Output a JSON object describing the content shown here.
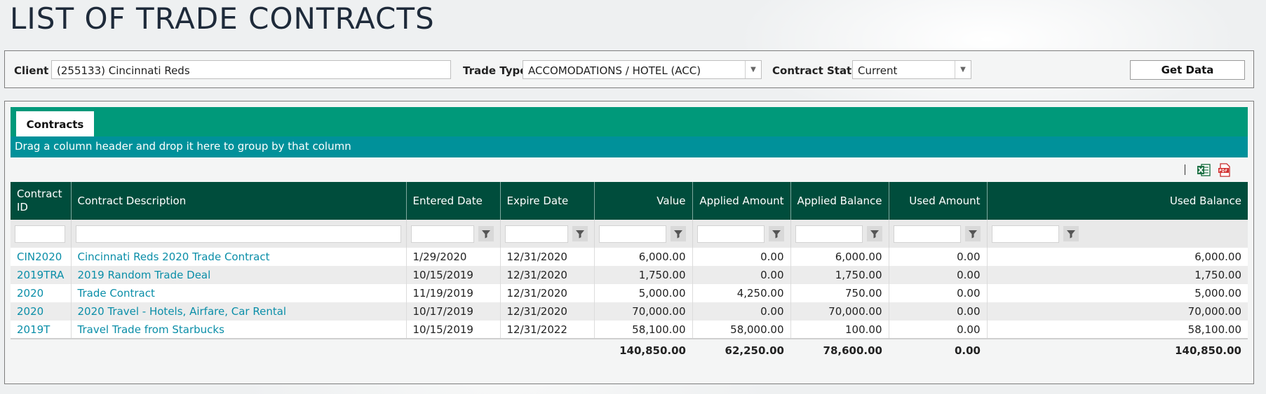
{
  "page": {
    "title": "LIST OF TRADE CONTRACTS"
  },
  "filters": {
    "client_label": "Client",
    "client_value": "(255133) Cincinnati Reds",
    "trade_type_label": "Trade Type",
    "trade_type_value": "ACCOMODATIONS / HOTEL (ACC)",
    "status_label": "Contract Status",
    "status_value": "Current",
    "get_data_label": "Get Data"
  },
  "tabs": [
    {
      "label": "Contracts",
      "active": true
    }
  ],
  "group_hint": "Drag a column header and drop it here to group by that column",
  "toolbar": {
    "icons": [
      "excel-export-icon",
      "pdf-export-icon"
    ]
  },
  "columns": [
    {
      "key": "id",
      "label": "Contract ID"
    },
    {
      "key": "desc",
      "label": "Contract Description"
    },
    {
      "key": "entered",
      "label": "Entered Date"
    },
    {
      "key": "expire",
      "label": "Expire Date"
    },
    {
      "key": "value",
      "label": "Value"
    },
    {
      "key": "applied_amount",
      "label": "Applied Amount"
    },
    {
      "key": "applied_balance",
      "label": "Applied Balance"
    },
    {
      "key": "used_amount",
      "label": "Used Amount"
    },
    {
      "key": "used_balance",
      "label": "Used Balance"
    }
  ],
  "rows": [
    {
      "id": "CIN2020",
      "desc": "Cincinnati Reds 2020 Trade Contract",
      "entered": "1/29/2020",
      "expire": "12/31/2020",
      "value": "6,000.00",
      "applied_amount": "0.00",
      "applied_balance": "6,000.00",
      "used_amount": "0.00",
      "used_balance": "6,000.00"
    },
    {
      "id": "2019TRA",
      "desc": "2019 Random Trade Deal",
      "entered": "10/15/2019",
      "expire": "12/31/2020",
      "value": "1,750.00",
      "applied_amount": "0.00",
      "applied_balance": "1,750.00",
      "used_amount": "0.00",
      "used_balance": "1,750.00"
    },
    {
      "id": "2020",
      "desc": "Trade Contract",
      "entered": "11/19/2019",
      "expire": "12/31/2020",
      "value": "5,000.00",
      "applied_amount": "4,250.00",
      "applied_balance": "750.00",
      "used_amount": "0.00",
      "used_balance": "5,000.00"
    },
    {
      "id": "2020",
      "desc": "2020 Travel - Hotels, Airfare, Car Rental",
      "entered": "10/17/2019",
      "expire": "12/31/2020",
      "value": "70,000.00",
      "applied_amount": "0.00",
      "applied_balance": "70,000.00",
      "used_amount": "0.00",
      "used_balance": "70,000.00"
    },
    {
      "id": "2019T",
      "desc": "Travel Trade from Starbucks",
      "entered": "10/15/2019",
      "expire": "12/31/2022",
      "value": "58,100.00",
      "applied_amount": "58,000.00",
      "applied_balance": "100.00",
      "used_amount": "0.00",
      "used_balance": "58,100.00"
    }
  ],
  "totals": {
    "value": "140,850.00",
    "applied_amount": "62,250.00",
    "applied_balance": "78,600.00",
    "used_amount": "0.00",
    "used_balance": "140,850.00"
  },
  "colors": {
    "header_bg": "#004d3c",
    "tab_strip": "#00997a",
    "group_bar": "#00919a",
    "link": "#0a8ea8"
  }
}
